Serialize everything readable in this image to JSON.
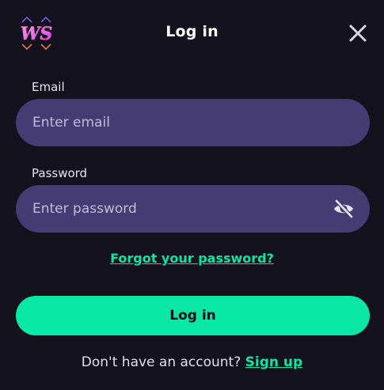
{
  "header": {
    "title": "Log in",
    "logo_text": "WS"
  },
  "form": {
    "email_label": "Email",
    "email_placeholder": "Enter email",
    "email_value": "",
    "password_label": "Password",
    "password_placeholder": "Enter password",
    "password_value": "",
    "forgot_link": "Forgot your password?",
    "submit_label": "Log in"
  },
  "footer": {
    "prompt": "Don't have an account? ",
    "signup_link": "Sign up"
  },
  "icons": {
    "close": "close-icon",
    "password_visibility": "eye-slash-icon",
    "logo": "ws-logo"
  },
  "colors": {
    "background": "#13121d",
    "input_bg": "#463c74",
    "accent": "#08e8a4",
    "text": "#ffffff"
  }
}
